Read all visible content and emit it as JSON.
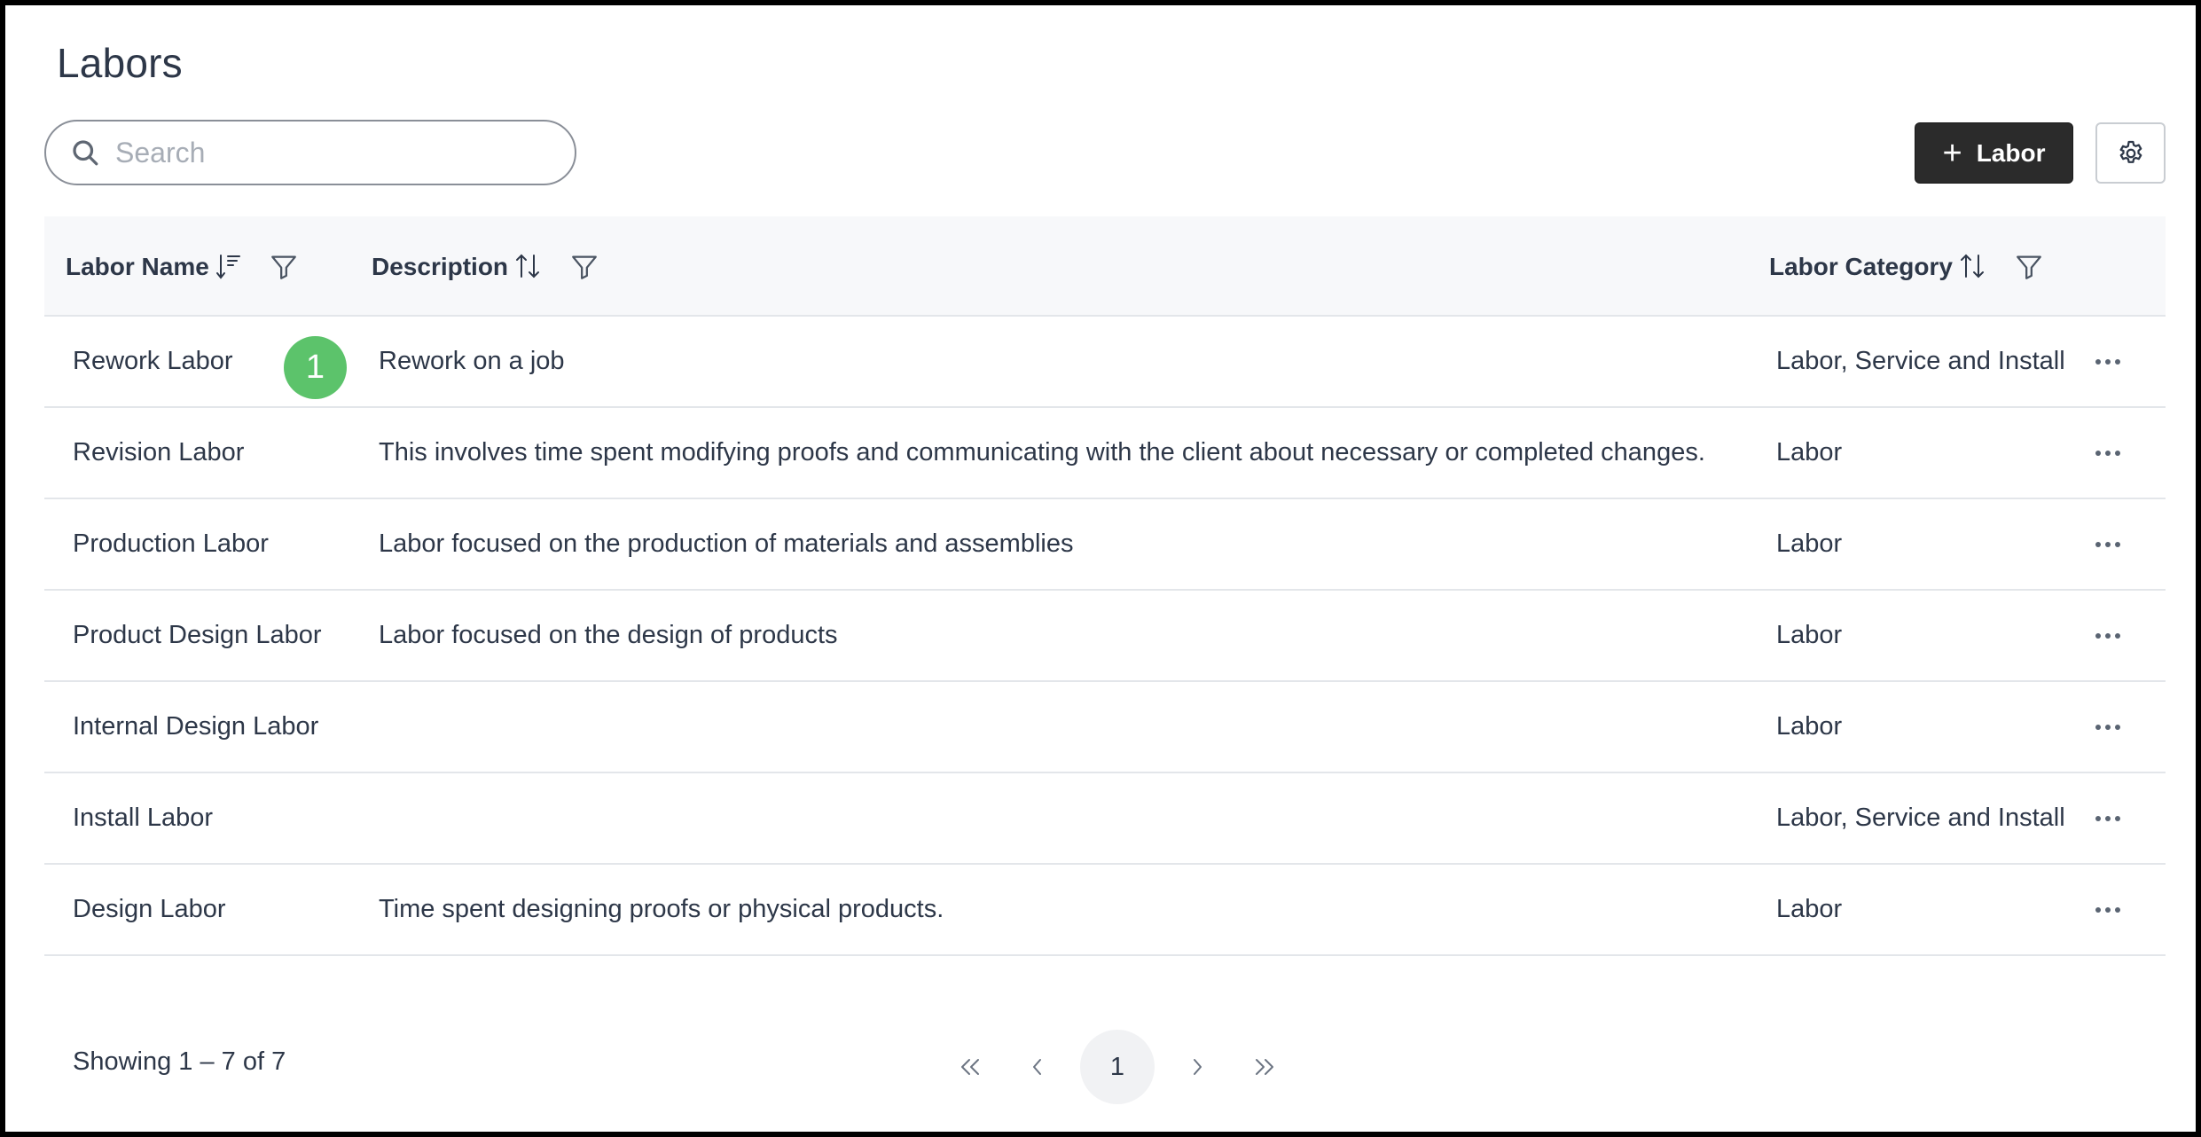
{
  "page": {
    "title": "Labors"
  },
  "search": {
    "placeholder": "Search",
    "value": "",
    "icon": "search-icon"
  },
  "toolbar": {
    "add_label": "Labor",
    "add_icon": "plus-icon",
    "settings_icon": "gear-icon",
    "accent_color": "#2b2b2b"
  },
  "table": {
    "columns": [
      {
        "label": "Labor Name",
        "sort_icon": "sort-descending-icon",
        "filter_icon": "filter-icon"
      },
      {
        "label": "Description",
        "sort_icon": "sort-icon",
        "filter_icon": "filter-icon"
      },
      {
        "label": "Labor Category",
        "sort_icon": "sort-icon",
        "filter_icon": "filter-icon"
      }
    ],
    "rows": [
      {
        "name": "Rework Labor",
        "description": "Rework on a job",
        "category": "Labor, Service and Install"
      },
      {
        "name": "Revision Labor",
        "description": "This involves time spent modifying proofs and communicating with the client about necessary or completed changes.",
        "category": "Labor"
      },
      {
        "name": "Production Labor",
        "description": "Labor focused on the production of materials and assemblies",
        "category": "Labor"
      },
      {
        "name": "Product Design Labor",
        "description": "Labor focused on the design of products",
        "category": "Labor"
      },
      {
        "name": "Internal Design Labor",
        "description": "",
        "category": "Labor"
      },
      {
        "name": "Install Labor",
        "description": "",
        "category": "Labor, Service and Install"
      },
      {
        "name": "Design Labor",
        "description": "Time spent designing proofs or physical products.",
        "category": "Labor"
      }
    ],
    "row_menu_icon": "more-horizontal-icon"
  },
  "annotation": {
    "marker": "1",
    "color": "#5cc36b"
  },
  "footer": {
    "showing": "Showing 1 – 7 of 7",
    "current_page": "1"
  }
}
